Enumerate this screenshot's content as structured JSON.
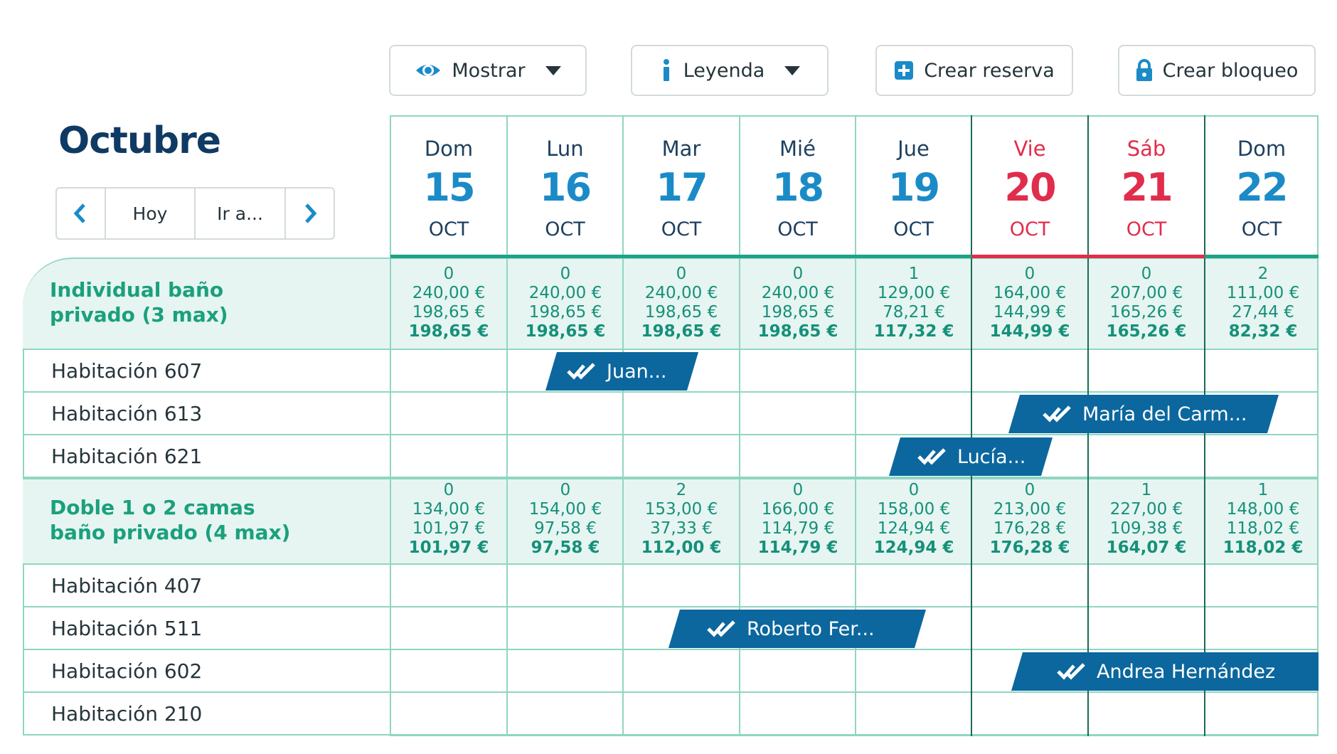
{
  "toolbar": {
    "show_label": "Mostrar",
    "legend_label": "Leyenda",
    "create_booking_label": "Crear reserva",
    "create_block_label": "Crear bloqueo",
    "accent_color": "#1b8bc8"
  },
  "month": "Octubre",
  "nav": {
    "today_label": "Hoy",
    "goto_label": "Ir a..."
  },
  "days": [
    {
      "name": "Dom",
      "num": "15",
      "mon": "OCT",
      "weekend": false
    },
    {
      "name": "Lun",
      "num": "16",
      "mon": "OCT",
      "weekend": false
    },
    {
      "name": "Mar",
      "num": "17",
      "mon": "OCT",
      "weekend": false
    },
    {
      "name": "Mié",
      "num": "18",
      "mon": "OCT",
      "weekend": false
    },
    {
      "name": "Jue",
      "num": "19",
      "mon": "OCT",
      "weekend": false
    },
    {
      "name": "Vie",
      "num": "20",
      "mon": "OCT",
      "weekend": true
    },
    {
      "name": "Sáb",
      "num": "21",
      "mon": "OCT",
      "weekend": true
    },
    {
      "name": "Dom",
      "num": "22",
      "mon": "OCT",
      "weekend": false
    }
  ],
  "categories": [
    {
      "name_line1": "Individual baño",
      "name_line2": "privado (3 max)",
      "rates": [
        {
          "avail": "0",
          "a": "240,00 €",
          "b": "198,65 €",
          "total": "198,65 €"
        },
        {
          "avail": "0",
          "a": "240,00 €",
          "b": "198,65 €",
          "total": "198,65 €"
        },
        {
          "avail": "0",
          "a": "240,00 €",
          "b": "198,65 €",
          "total": "198,65 €"
        },
        {
          "avail": "0",
          "a": "240,00 €",
          "b": "198,65 €",
          "total": "198,65 €"
        },
        {
          "avail": "1",
          "a": "129,00 €",
          "b": "78,21 €",
          "total": "117,32 €"
        },
        {
          "avail": "0",
          "a": "164,00 €",
          "b": "144,99 €",
          "total": "144,99 €"
        },
        {
          "avail": "0",
          "a": "207,00 €",
          "b": "165,26 €",
          "total": "165,26 €"
        },
        {
          "avail": "2",
          "a": "111,00 €",
          "b": "27,44 €",
          "total": "82,32 €"
        }
      ],
      "rooms": [
        "Habitación 607",
        "Habitación 613",
        "Habitación 621"
      ]
    },
    {
      "name_line1": "Doble 1 o 2 camas",
      "name_line2": "baño privado (4 max)",
      "rates": [
        {
          "avail": "0",
          "a": "134,00 €",
          "b": "101,97 €",
          "total": "101,97 €"
        },
        {
          "avail": "0",
          "a": "154,00 €",
          "b": "97,58 €",
          "total": "97,58 €"
        },
        {
          "avail": "2",
          "a": "153,00 €",
          "b": "37,33 €",
          "total": "112,00 €"
        },
        {
          "avail": "0",
          "a": "166,00 €",
          "b": "114,79 €",
          "total": "114,79 €"
        },
        {
          "avail": "0",
          "a": "158,00 €",
          "b": "124,94 €",
          "total": "124,94 €"
        },
        {
          "avail": "0",
          "a": "213,00 €",
          "b": "176,28 €",
          "total": "176,28 €"
        },
        {
          "avail": "1",
          "a": "227,00 €",
          "b": "109,38 €",
          "total": "164,07 €"
        },
        {
          "avail": "1",
          "a": "148,00 €",
          "b": "118,02 €",
          "total": "118,02 €"
        }
      ],
      "rooms": [
        "Habitación 407",
        "Habitación 511",
        "Habitación 602",
        "Habitación 210"
      ]
    }
  ],
  "bookings": [
    {
      "guest": "Juan...",
      "room": "Habitación 607",
      "status": "confirmed"
    },
    {
      "guest": "María del Carm...",
      "room": "Habitación 613",
      "status": "confirmed"
    },
    {
      "guest": "Lucía...",
      "room": "Habitación 621",
      "status": "confirmed"
    },
    {
      "guest": "Roberto Fer...",
      "room": "Habitación 511",
      "status": "confirmed"
    },
    {
      "guest": "Andrea Hernández",
      "room": "Habitación 602",
      "status": "confirmed"
    }
  ]
}
